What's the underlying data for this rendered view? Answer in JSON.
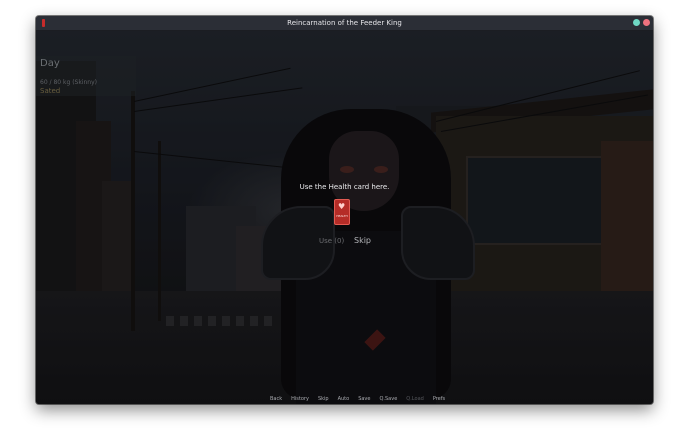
{
  "window": {
    "title": "Reincarnation of the Feeder King"
  },
  "hud": {
    "time_of_day": "Day",
    "weight": "60 / 80 kg (Skinny)",
    "status": "Sated"
  },
  "prompt": {
    "text": "Use the Health card here.",
    "card_label": "HEALTH",
    "use_label": "Use (0)",
    "skip_label": "Skip"
  },
  "quick_menu": [
    {
      "label": "Back",
      "enabled": true
    },
    {
      "label": "History",
      "enabled": true
    },
    {
      "label": "Skip",
      "enabled": true
    },
    {
      "label": "Auto",
      "enabled": true
    },
    {
      "label": "Save",
      "enabled": true
    },
    {
      "label": "Q.Save",
      "enabled": true
    },
    {
      "label": "Q.Load",
      "enabled": false
    },
    {
      "label": "Prefs",
      "enabled": true
    }
  ],
  "icons": {
    "app": "app-icon",
    "maximize": "maximize-icon",
    "close": "close-icon",
    "card": "health-card-icon"
  },
  "colors": {
    "titlebar": "#2b2e36",
    "maximize": "#6fd8c4",
    "close": "#f0727f",
    "card": "#b52c27"
  }
}
